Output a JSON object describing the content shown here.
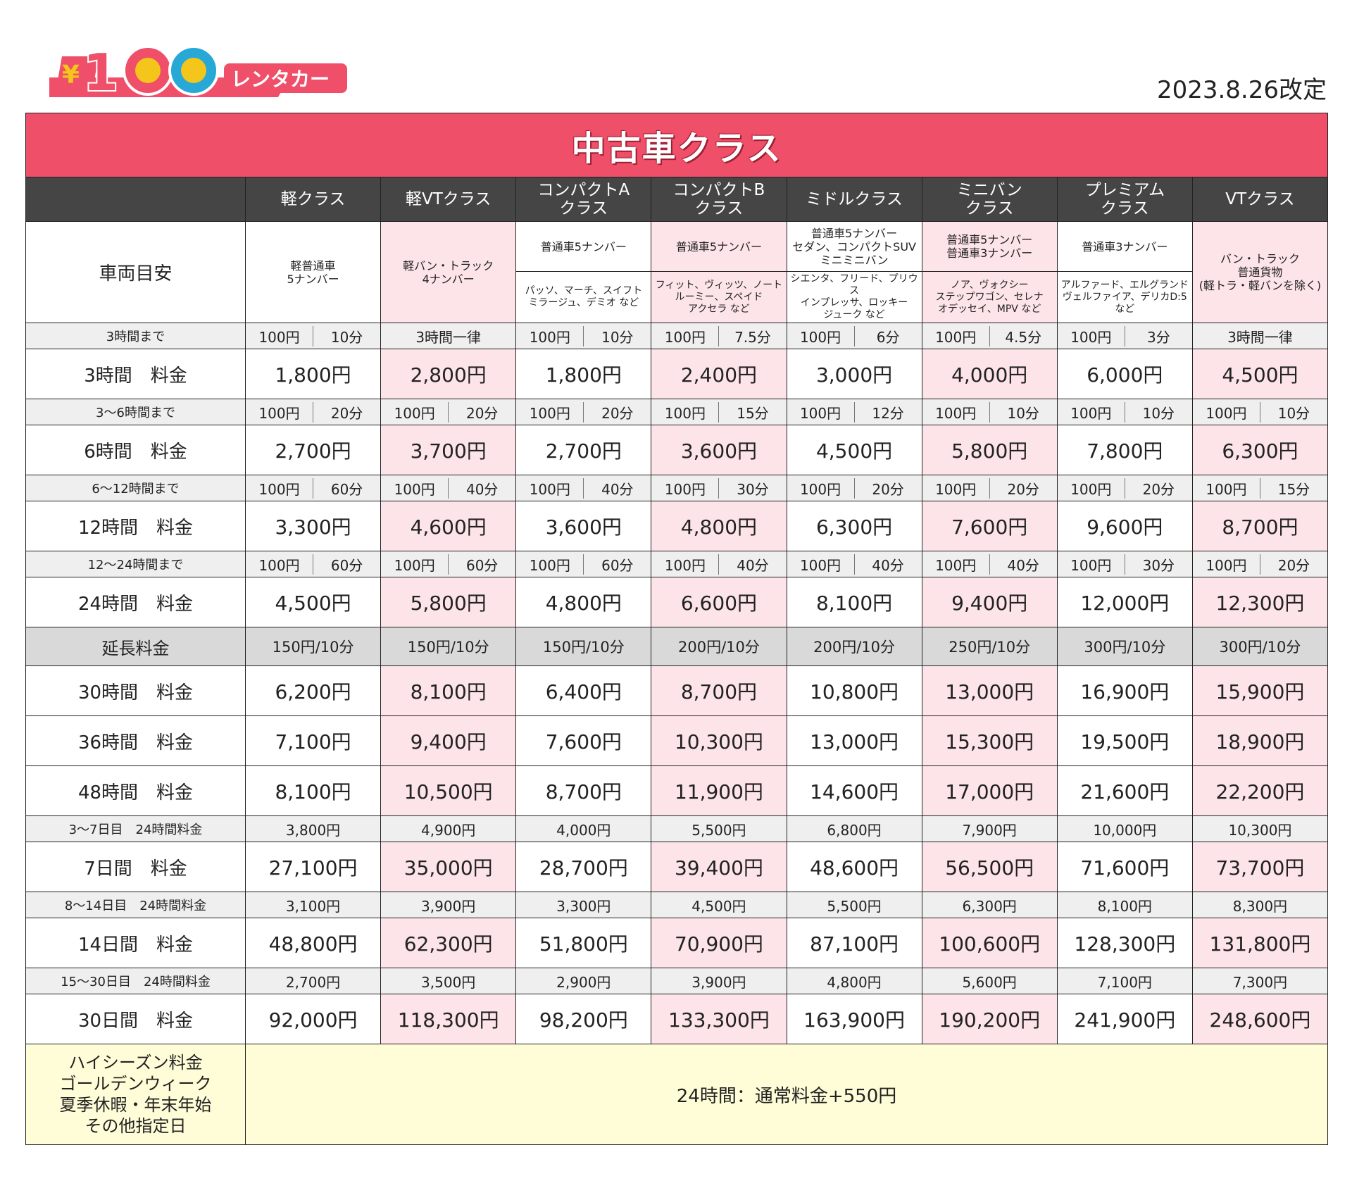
{
  "brand": {
    "logo_text": "¥100 レンタカー",
    "colors": {
      "pink": "#ef4f68",
      "yellow": "#f4c51a",
      "cyan": "#27a8d6"
    }
  },
  "revised_date": "2023.8.26改定",
  "title": "中古車クラス",
  "classes": [
    {
      "name": "軽クラス",
      "vehicle": "軽普通車\n5ナンバー",
      "sub": ""
    },
    {
      "name": "軽VTクラス",
      "vehicle": "軽バン・トラック\n4ナンバー",
      "sub": ""
    },
    {
      "name": "コンパクトA\nクラス",
      "vehicle": "普通車5ナンバー",
      "sub": "パッソ、マーチ、スイフト\nミラージュ、デミオ など"
    },
    {
      "name": "コンパクトB\nクラス",
      "vehicle": "普通車5ナンバー",
      "sub": "フィット、ヴィッツ、ノート\nルーミー、スペイド\nアクセラ など"
    },
    {
      "name": "ミドルクラス",
      "vehicle": "普通車5ナンバー\nセダン、コンパクトSUV\nミニミニバン",
      "sub": "シエンタ、フリード、プリウス\nインプレッサ、ロッキー\nジューク など"
    },
    {
      "name": "ミニバン\nクラス",
      "vehicle": "普通車5ナンバー\n普通車3ナンバー",
      "sub": "ノア、ヴォクシー\nステップワゴン、セレナ\nオデッセイ、MPV など"
    },
    {
      "name": "プレミアム\nクラス",
      "vehicle": "普通車3ナンバー",
      "sub": "アルファード、エルグランド\nヴェルファイア、デリカD:5\nなど"
    },
    {
      "name": "VTクラス",
      "vehicle": "バン・トラック\n普通貨物\n(軽トラ・軽バンを除く)",
      "sub": ""
    }
  ],
  "vehicle_label": "車両目安",
  "rows": [
    {
      "type": "sub",
      "label": "3時間まで",
      "cells": [
        [
          "100円",
          "10分"
        ],
        [
          "3時間一律"
        ],
        [
          "100円",
          "10分"
        ],
        [
          "100円",
          "7.5分"
        ],
        [
          "100円",
          "6分"
        ],
        [
          "100円",
          "4.5分"
        ],
        [
          "100円",
          "3分"
        ],
        [
          "3時間一律"
        ]
      ]
    },
    {
      "type": "main",
      "label": "3時間　料金",
      "values": [
        "1,800円",
        "2,800円",
        "1,800円",
        "2,400円",
        "3,000円",
        "4,000円",
        "6,000円",
        "4,500円"
      ]
    },
    {
      "type": "sub",
      "label": "3～6時間まで",
      "cells": [
        [
          "100円",
          "20分"
        ],
        [
          "100円",
          "20分"
        ],
        [
          "100円",
          "20分"
        ],
        [
          "100円",
          "15分"
        ],
        [
          "100円",
          "12分"
        ],
        [
          "100円",
          "10分"
        ],
        [
          "100円",
          "10分"
        ],
        [
          "100円",
          "10分"
        ]
      ]
    },
    {
      "type": "main",
      "label": "6時間　料金",
      "values": [
        "2,700円",
        "3,700円",
        "2,700円",
        "3,600円",
        "4,500円",
        "5,800円",
        "7,800円",
        "6,300円"
      ]
    },
    {
      "type": "sub",
      "label": "6～12時間まで",
      "cells": [
        [
          "100円",
          "60分"
        ],
        [
          "100円",
          "40分"
        ],
        [
          "100円",
          "40分"
        ],
        [
          "100円",
          "30分"
        ],
        [
          "100円",
          "20分"
        ],
        [
          "100円",
          "20分"
        ],
        [
          "100円",
          "20分"
        ],
        [
          "100円",
          "15分"
        ]
      ]
    },
    {
      "type": "main",
      "label": "12時間　料金",
      "values": [
        "3,300円",
        "4,600円",
        "3,600円",
        "4,800円",
        "6,300円",
        "7,600円",
        "9,600円",
        "8,700円"
      ]
    },
    {
      "type": "sub",
      "label": "12～24時間まで",
      "cells": [
        [
          "100円",
          "60分"
        ],
        [
          "100円",
          "60分"
        ],
        [
          "100円",
          "60分"
        ],
        [
          "100円",
          "40分"
        ],
        [
          "100円",
          "40分"
        ],
        [
          "100円",
          "40分"
        ],
        [
          "100円",
          "30分"
        ],
        [
          "100円",
          "20分"
        ]
      ]
    },
    {
      "type": "main",
      "label": "24時間　料金",
      "values": [
        "4,500円",
        "5,800円",
        "4,800円",
        "6,600円",
        "8,100円",
        "9,400円",
        "12,000円",
        "12,300円"
      ]
    },
    {
      "type": "ext",
      "label": "延長料金",
      "values": [
        "150円/10分",
        "150円/10分",
        "150円/10分",
        "200円/10分",
        "200円/10分",
        "250円/10分",
        "300円/10分",
        "300円/10分"
      ]
    },
    {
      "type": "main",
      "label": "30時間　料金",
      "values": [
        "6,200円",
        "8,100円",
        "6,400円",
        "8,700円",
        "10,800円",
        "13,000円",
        "16,900円",
        "15,900円"
      ]
    },
    {
      "type": "main",
      "label": "36時間　料金",
      "values": [
        "7,100円",
        "9,400円",
        "7,600円",
        "10,300円",
        "13,000円",
        "15,300円",
        "19,500円",
        "18,900円"
      ]
    },
    {
      "type": "main",
      "label": "48時間　料金",
      "values": [
        "8,100円",
        "10,500円",
        "8,700円",
        "11,900円",
        "14,600円",
        "17,000円",
        "21,600円",
        "22,200円"
      ]
    },
    {
      "type": "sub1",
      "label": "3～7日目　24時間料金",
      "values": [
        "3,800円",
        "4,900円",
        "4,000円",
        "5,500円",
        "6,800円",
        "7,900円",
        "10,000円",
        "10,300円"
      ]
    },
    {
      "type": "main",
      "label": "7日間　料金",
      "values": [
        "27,100円",
        "35,000円",
        "28,700円",
        "39,400円",
        "48,600円",
        "56,500円",
        "71,600円",
        "73,700円"
      ]
    },
    {
      "type": "sub1",
      "label": "8～14日目　24時間料金",
      "values": [
        "3,100円",
        "3,900円",
        "3,300円",
        "4,500円",
        "5,500円",
        "6,300円",
        "8,100円",
        "8,300円"
      ]
    },
    {
      "type": "main",
      "label": "14日間　料金",
      "values": [
        "48,800円",
        "62,300円",
        "51,800円",
        "70,900円",
        "87,100円",
        "100,600円",
        "128,300円",
        "131,800円"
      ]
    },
    {
      "type": "sub1",
      "label": "15～30日目　24時間料金",
      "values": [
        "2,700円",
        "3,500円",
        "2,900円",
        "3,900円",
        "4,800円",
        "5,600円",
        "7,100円",
        "7,300円"
      ]
    },
    {
      "type": "main",
      "label": "30日間　料金",
      "values": [
        "92,000円",
        "118,300円",
        "98,200円",
        "133,300円",
        "163,900円",
        "190,200円",
        "241,900円",
        "248,600円"
      ]
    }
  ],
  "season": {
    "label": "ハイシーズン料金\nゴールデンウィーク\n夏季休暇・年末年始\nその他指定日",
    "value": "24時間：通常料金+550円"
  }
}
